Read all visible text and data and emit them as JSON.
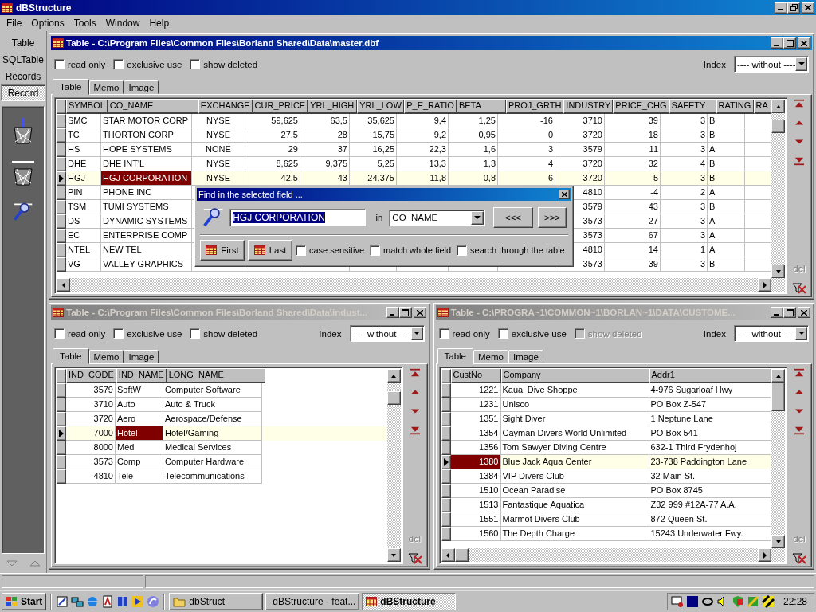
{
  "app": {
    "title": "dBStructure"
  },
  "menu": [
    {
      "label": "File"
    },
    {
      "label": "Options"
    },
    {
      "label": "Tools"
    },
    {
      "label": "Window"
    },
    {
      "label": "Help"
    }
  ],
  "sidebar": {
    "items": [
      {
        "label": "Table",
        "selected": false
      },
      {
        "label": "SQLTable",
        "selected": false
      },
      {
        "label": "Records",
        "selected": false
      },
      {
        "label": "Record",
        "selected": true
      }
    ]
  },
  "windows": [
    {
      "title": "Table - C:\\Program Files\\Common Files\\Borland Shared\\Data\\master.dbf",
      "active": true,
      "options": [
        {
          "label": "read only",
          "checked": false,
          "disabled": false
        },
        {
          "label": "exclusive use",
          "checked": false,
          "disabled": false
        },
        {
          "label": "show deleted",
          "checked": false,
          "disabled": false
        }
      ],
      "index": {
        "label": "Index",
        "value": "---- without ----"
      },
      "tabs": [
        {
          "label": "Table",
          "selected": true
        },
        {
          "label": "Memo",
          "selected": false
        },
        {
          "label": "Image",
          "selected": false
        }
      ],
      "table": {
        "columns": [
          {
            "label": "SYMBOL",
            "selected": false
          },
          {
            "label": "CO_NAME",
            "selected": true
          },
          {
            "label": "EXCHANGE",
            "selected": false
          },
          {
            "label": "CUR_PRICE",
            "selected": false
          },
          {
            "label": "YRL_HIGH",
            "selected": false
          },
          {
            "label": "YRL_LOW",
            "selected": false
          },
          {
            "label": "P_E_RATIO",
            "selected": false
          },
          {
            "label": "BETA",
            "selected": false
          },
          {
            "label": "PROJ_GRTH",
            "selected": false
          },
          {
            "label": "INDUSTRY",
            "selected": false
          },
          {
            "label": "PRICE_CHG",
            "selected": false
          },
          {
            "label": "SAFETY",
            "selected": false
          },
          {
            "label": "RATING",
            "selected": false
          },
          {
            "label": "RA",
            "selected": false
          }
        ],
        "rows": [
          {
            "current": false,
            "cells": [
              "SMC",
              "STAR MOTOR CORP",
              "NYSE",
              "59,625",
              "63,5",
              "35,625",
              "9,4",
              "1,25",
              "-16",
              "3710",
              "39",
              "3",
              "B"
            ]
          },
          {
            "current": false,
            "cells": [
              "TC",
              "THORTON CORP",
              "NYSE",
              "27,5",
              "28",
              "15,75",
              "9,2",
              "0,95",
              "0",
              "3720",
              "18",
              "3",
              "B"
            ]
          },
          {
            "current": false,
            "cells": [
              "HS",
              "HOPE SYSTEMS",
              "NONE",
              "29",
              "37",
              "16,25",
              "22,3",
              "1,6",
              "3",
              "3579",
              "11",
              "3",
              "A"
            ]
          },
          {
            "current": false,
            "cells": [
              "DHE",
              "DHE INT'L",
              "NYSE",
              "8,625",
              "9,375",
              "5,25",
              "13,3",
              "1,3",
              "4",
              "3720",
              "32",
              "4",
              "B"
            ]
          },
          {
            "current": true,
            "cells": [
              "HGJ",
              "HGJ CORPORATION",
              "NYSE",
              "42,5",
              "43",
              "24,375",
              "11,8",
              "0,8",
              "6",
              "3720",
              "5",
              "3",
              "B"
            ]
          },
          {
            "current": false,
            "cells": [
              "PIN",
              "PHONE INC",
              null,
              null,
              null,
              null,
              null,
              null,
              null,
              "4810",
              "-4",
              "2",
              "A"
            ]
          },
          {
            "current": false,
            "cells": [
              "TSM",
              "TUMI SYSTEMS",
              null,
              null,
              null,
              null,
              null,
              null,
              null,
              "3579",
              "43",
              "3",
              "B"
            ]
          },
          {
            "current": false,
            "cells": [
              "DS",
              "DYNAMIC SYSTEMS",
              null,
              null,
              null,
              null,
              null,
              null,
              null,
              "3573",
              "27",
              "3",
              "A"
            ]
          },
          {
            "current": false,
            "cells": [
              "EC",
              "ENTERPRISE COMP",
              null,
              null,
              null,
              null,
              null,
              null,
              null,
              "3573",
              "67",
              "3",
              "A"
            ]
          },
          {
            "current": false,
            "cells": [
              "NTEL",
              "NEW TEL",
              null,
              null,
              null,
              null,
              null,
              null,
              null,
              "4810",
              "14",
              "1",
              "A"
            ]
          },
          {
            "current": false,
            "cells": [
              "VG",
              "VALLEY GRAPHICS",
              null,
              null,
              null,
              null,
              null,
              null,
              null,
              "3573",
              "39",
              "3",
              "B"
            ]
          }
        ]
      },
      "del_label": "del"
    },
    {
      "title": "Table - C:\\Program Files\\Common Files\\Borland Shared\\Data\\indust...",
      "active": false,
      "options": [
        {
          "label": "read only",
          "checked": false,
          "disabled": false
        },
        {
          "label": "exclusive use",
          "checked": false,
          "disabled": false
        },
        {
          "label": "show deleted",
          "checked": false,
          "disabled": false
        }
      ],
      "index": {
        "label": "Index",
        "value": "---- without ----"
      },
      "tabs": [
        {
          "label": "Table",
          "selected": true
        },
        {
          "label": "Memo",
          "selected": false
        },
        {
          "label": "Image",
          "selected": false
        }
      ],
      "table": {
        "columns": [
          {
            "label": "IND_CODE",
            "selected": false
          },
          {
            "label": "IND_NAME",
            "selected": true
          },
          {
            "label": "LONG_NAME",
            "selected": false
          }
        ],
        "rows": [
          {
            "current": false,
            "cells": [
              "3579",
              "SoftW",
              "Computer Software"
            ]
          },
          {
            "current": false,
            "cells": [
              "3710",
              "Auto",
              "Auto & Truck"
            ]
          },
          {
            "current": false,
            "cells": [
              "3720",
              "Aero",
              "Aerospace/Defense"
            ]
          },
          {
            "current": true,
            "cells": [
              "7000",
              "Hotel",
              "Hotel/Gaming"
            ]
          },
          {
            "current": false,
            "cells": [
              "8000",
              "Med",
              "Medical Services"
            ]
          },
          {
            "current": false,
            "cells": [
              "3573",
              "Comp",
              "Computer Hardware"
            ]
          },
          {
            "current": false,
            "cells": [
              "4810",
              "Tele",
              "Telecommunications"
            ]
          }
        ]
      },
      "del_label": "del"
    },
    {
      "title": "Table - C:\\PROGRA~1\\COMMON~1\\BORLAN~1\\DATA\\CUSTOME...",
      "active": false,
      "options": [
        {
          "label": "read only",
          "checked": false,
          "disabled": false
        },
        {
          "label": "exclusive use",
          "checked": false,
          "disabled": false
        },
        {
          "label": "show deleted",
          "checked": false,
          "disabled": true
        }
      ],
      "index": {
        "label": "Index",
        "value": "---- without ----"
      },
      "tabs": [
        {
          "label": "Table",
          "selected": true
        },
        {
          "label": "Memo",
          "selected": false
        },
        {
          "label": "Image",
          "selected": false
        }
      ],
      "table": {
        "columns": [
          {
            "label": "CustNo",
            "selected": true
          },
          {
            "label": "Company",
            "selected": false
          },
          {
            "label": "Addr1",
            "selected": false
          }
        ],
        "rows": [
          {
            "current": false,
            "cells": [
              "1221",
              "Kauai Dive Shoppe",
              "4-976 Sugarloaf Hwy"
            ]
          },
          {
            "current": false,
            "cells": [
              "1231",
              "Unisco",
              "PO Box Z-547"
            ]
          },
          {
            "current": false,
            "cells": [
              "1351",
              "Sight Diver",
              "1 Neptune Lane"
            ]
          },
          {
            "current": false,
            "cells": [
              "1354",
              "Cayman Divers World Unlimited",
              "PO Box 541"
            ]
          },
          {
            "current": false,
            "cells": [
              "1356",
              "Tom Sawyer Diving Centre",
              "632-1 Third Frydenhoj"
            ]
          },
          {
            "current": true,
            "cells": [
              "1380",
              "Blue Jack Aqua Center",
              "23-738 Paddington Lane"
            ]
          },
          {
            "current": false,
            "cells": [
              "1384",
              "VIP Divers Club",
              "32 Main St."
            ]
          },
          {
            "current": false,
            "cells": [
              "1510",
              "Ocean Paradise",
              "PO Box 8745"
            ]
          },
          {
            "current": false,
            "cells": [
              "1513",
              "Fantastique Aquatica",
              "Z32 999 #12A-77 A.A."
            ]
          },
          {
            "current": false,
            "cells": [
              "1551",
              "Marmot Divers Club",
              "872 Queen St."
            ]
          },
          {
            "current": false,
            "cells": [
              "1560",
              "The Depth Charge",
              "15243 Underwater Fwy."
            ]
          }
        ]
      },
      "del_label": "del"
    }
  ],
  "find_dialog": {
    "title": "Find in the selected field ...",
    "value": "HGJ CORPORATION",
    "in_label": "in",
    "field": "CO_NAME",
    "prev": "<<<",
    "next": ">>>",
    "first": "First",
    "last": "Last",
    "options": [
      {
        "label": "case sensitive",
        "checked": false
      },
      {
        "label": "match whole field",
        "checked": false
      },
      {
        "label": "search through the table",
        "checked": false
      }
    ]
  },
  "taskbar": {
    "start": "Start",
    "tasks": [
      {
        "label": "dbStruct",
        "selected": false
      },
      {
        "label": "dBStructure - feat...",
        "selected": false
      },
      {
        "label": "dBStructure",
        "selected": true
      }
    ],
    "clock": "22:28"
  }
}
